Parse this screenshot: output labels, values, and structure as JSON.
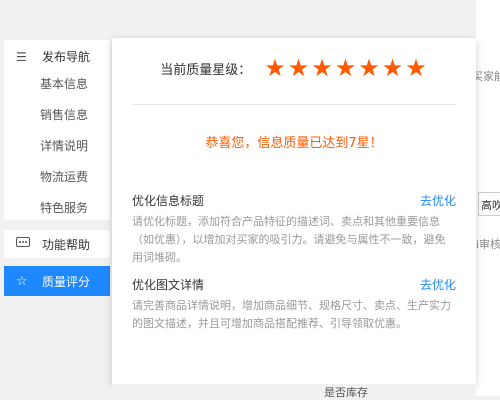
{
  "sidebar": {
    "nav_title": "发布导航",
    "items": [
      "基本信息",
      "销售信息",
      "详情说明",
      "物流运费",
      "特色服务"
    ],
    "help": "功能帮助",
    "quality": "质量评分"
  },
  "popup": {
    "stars_label": "当前质量星级：",
    "star_count": 7,
    "star_color": "#ff5a00",
    "congrats": "恭喜您，信息质量已达到7星！",
    "tips": [
      {
        "title": "优化信息标题",
        "link": "去优化",
        "desc": "请优化标题，添加符合产品特征的描述词、卖点和其他重要信息（如优惠），以增加对买家的吸引力。请避免与属性不一致，避免用词堆砌。"
      },
      {
        "title": "优化图文详情",
        "link": "去优化",
        "desc": "请完善商品详情说明，增加商品细节、规格尺寸、卖点、生产实力的图文描述，并且可增加商品搭配推荐、引导领取优惠。"
      }
    ]
  },
  "background": {
    "frag1": "买家能",
    "frag2": "高吹",
    "frag3": "i审核",
    "bottom": "是否库存"
  }
}
